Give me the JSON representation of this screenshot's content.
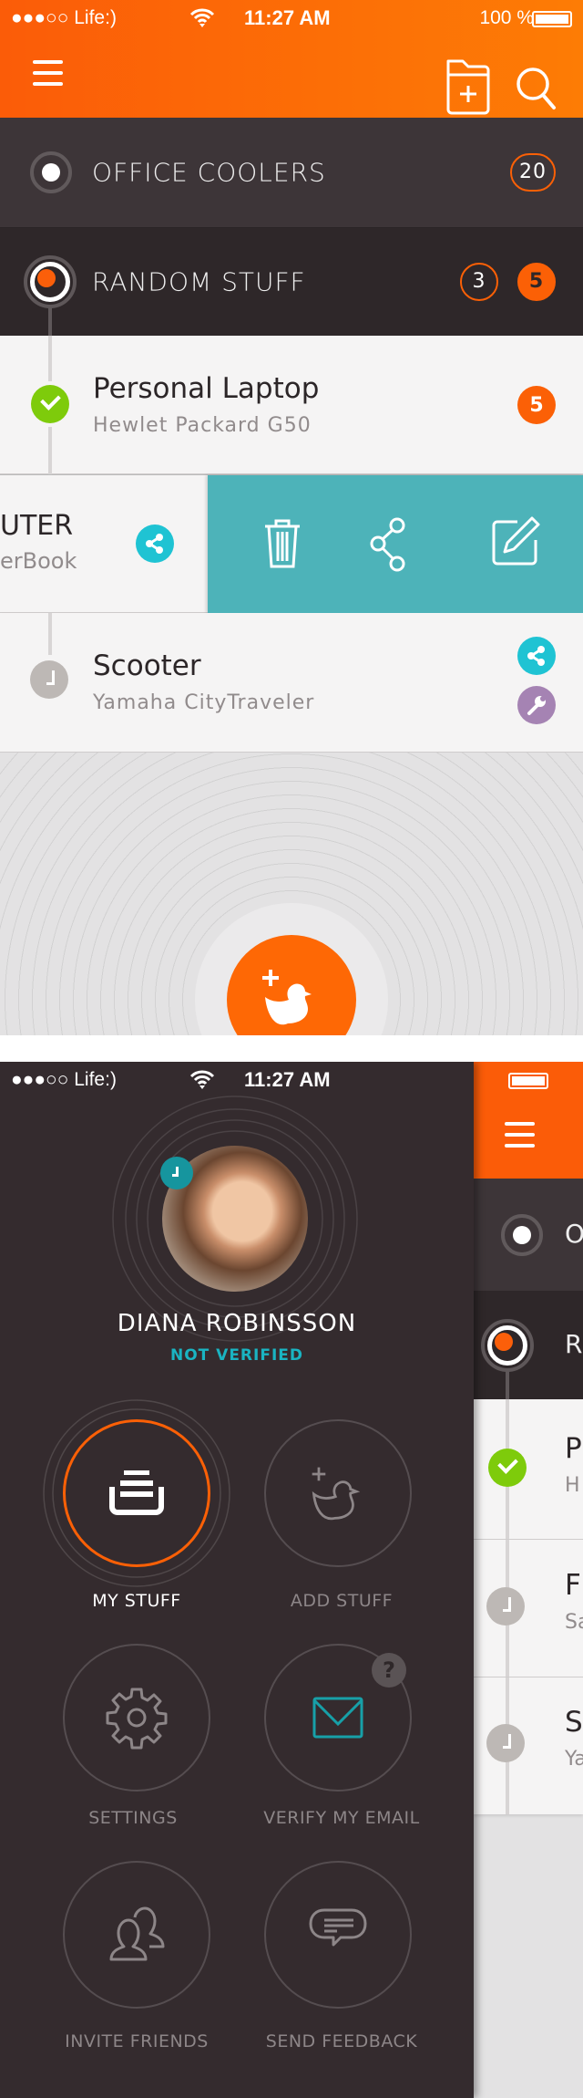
{
  "status_bar": {
    "carrier": "●●●○○ Life:)",
    "time": "11:27 AM",
    "battery_text": "100 %"
  },
  "header": {
    "menu_icon": "hamburger-icon",
    "add_folder_icon": "folder-plus-icon",
    "search_icon": "search-icon"
  },
  "categories": [
    {
      "label": "OFFICE COOLERS",
      "count": "20"
    },
    {
      "label": "RANDOM STUFF",
      "count_outline": "3",
      "count_filled": "5"
    }
  ],
  "items": [
    {
      "title": "Personal Laptop",
      "subtitle": "Hewlet Packard G50",
      "status": "done",
      "badge": "5"
    },
    {
      "title": "UTER",
      "subtitle": "erBook",
      "status": "swiped"
    },
    {
      "title": "Scooter",
      "subtitle": "Yamaha CityTraveler",
      "status": "pending"
    }
  ],
  "swipe_actions": [
    "delete",
    "share",
    "edit"
  ],
  "fab": {
    "icon": "add-duck-icon"
  },
  "colors": {
    "accent": "#fb6006",
    "teal": "#4db3b9",
    "share": "#1fc3d3",
    "tool": "#a583b3",
    "done": "#7ecb0b",
    "sidebar": "#342b2e"
  },
  "sidebar": {
    "status_bar": {
      "carrier": "●●●○○ Life:)",
      "time": "11:27 AM"
    },
    "user_name": "DIANA ROBINSSON",
    "verification": "NOT VERIFIED",
    "menu": [
      {
        "label": "MY STUFF",
        "icon": "my-stuff-icon",
        "active": true
      },
      {
        "label": "ADD STUFF",
        "icon": "add-duck-icon"
      },
      {
        "label": "SETTINGS",
        "icon": "gear-icon"
      },
      {
        "label": "VERIFY MY EMAIL",
        "icon": "envelope-icon",
        "hint": "?"
      },
      {
        "label": "INVITE FRIENDS",
        "icon": "users-icon"
      },
      {
        "label": "SEND FEEDBACK",
        "icon": "chat-bubble-icon"
      }
    ]
  },
  "peek": {
    "cat1": "O",
    "cat2": "R",
    "rows": [
      {
        "t": "P",
        "s": "H"
      },
      {
        "t": "F",
        "s": "Sa"
      },
      {
        "t": "S",
        "s": "Ya"
      }
    ]
  }
}
